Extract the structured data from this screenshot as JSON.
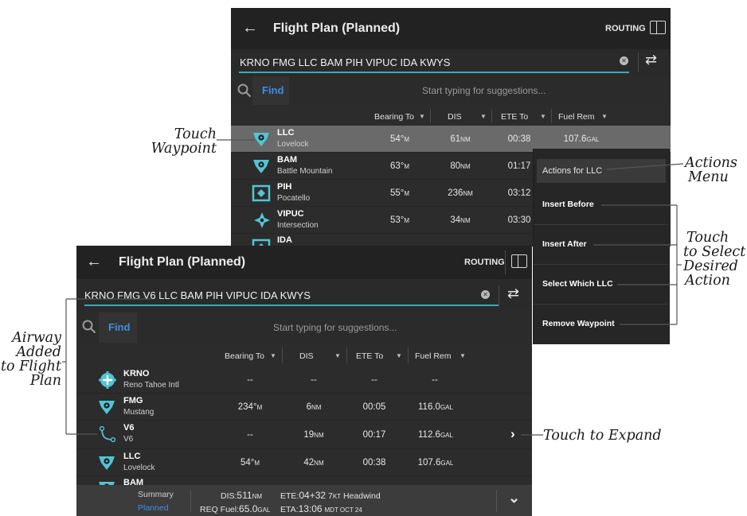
{
  "back_panel": {
    "title": "Flight Plan (Planned)",
    "routing_label": "ROUTING",
    "route_text": "KRNO FMG LLC BAM PIH VIPUC IDA KWYS",
    "find_label": "Find",
    "suggestion_placeholder": "Start typing for suggestions...",
    "columns": [
      "Bearing To",
      "DIS",
      "ETE To",
      "Fuel Rem"
    ],
    "rows": [
      {
        "id": "LLC",
        "name": "Lovelock",
        "bearing": "54°",
        "bearing_unit": "M",
        "dis": "61",
        "dis_unit": "NM",
        "ete": "00:38",
        "fuel": "107.6",
        "fuel_unit": "GAL",
        "icon": "vor-icon"
      },
      {
        "id": "BAM",
        "name": "Battle Mountain",
        "bearing": "63°",
        "bearing_unit": "M",
        "dis": "80",
        "dis_unit": "NM",
        "ete": "01:17",
        "fuel": "",
        "fuel_unit": "",
        "icon": "vor-icon"
      },
      {
        "id": "PIH",
        "name": "Pocatello",
        "bearing": "55°",
        "bearing_unit": "M",
        "dis": "236",
        "dis_unit": "NM",
        "ete": "03:12",
        "fuel": "",
        "fuel_unit": "",
        "icon": "vortac-icon"
      },
      {
        "id": "VIPUC",
        "name": "Intersection",
        "bearing": "53°",
        "bearing_unit": "M",
        "dis": "34",
        "dis_unit": "NM",
        "ete": "03:30",
        "fuel": "",
        "fuel_unit": "",
        "icon": "intersection-icon"
      },
      {
        "id": "IDA",
        "name": "",
        "icon": "vortac-icon"
      }
    ]
  },
  "actions_menu": {
    "title": "Actions for LLC",
    "items": [
      "Insert Before",
      "Insert After",
      "Select Which LLC",
      "Remove Waypoint"
    ]
  },
  "front_panel": {
    "title": "Flight Plan (Planned)",
    "routing_label": "ROUTING",
    "route_text": "KRNO FMG V6 LLC BAM PIH VIPUC IDA KWYS",
    "find_label": "Find",
    "suggestion_placeholder": "Start typing for suggestions...",
    "columns": [
      "Bearing To",
      "DIS",
      "ETE To",
      "Fuel Rem"
    ],
    "rows": [
      {
        "id": "KRNO",
        "name": "Reno Tahoe Intl",
        "bearing": "--",
        "bearing_unit": "",
        "dis": "--",
        "dis_unit": "",
        "ete": "--",
        "fuel": "--",
        "fuel_unit": "",
        "icon": "airport-icon"
      },
      {
        "id": "FMG",
        "name": "Mustang",
        "bearing": "234°",
        "bearing_unit": "M",
        "dis": "6",
        "dis_unit": "NM",
        "ete": "00:05",
        "fuel": "116.0",
        "fuel_unit": "GAL",
        "icon": "vor-icon"
      },
      {
        "id": "V6",
        "name": "V6",
        "bearing": "--",
        "bearing_unit": "",
        "dis": "19",
        "dis_unit": "NM",
        "ete": "00:17",
        "fuel": "112.6",
        "fuel_unit": "GAL",
        "icon": "airway-icon"
      },
      {
        "id": "LLC",
        "name": "Lovelock",
        "bearing": "54°",
        "bearing_unit": "M",
        "dis": "42",
        "dis_unit": "NM",
        "ete": "00:38",
        "fuel": "107.6",
        "fuel_unit": "GAL",
        "icon": "vor-icon"
      },
      {
        "id": "BAM",
        "name": "",
        "icon": "vor-icon"
      }
    ],
    "footer": {
      "summary_label": "Summary",
      "planned_label": "Planned",
      "dis_label": "DIS:",
      "dis_value": "511",
      "dis_unit": "NM",
      "req_fuel_label": "REQ Fuel:",
      "req_fuel_value": "65.0",
      "req_fuel_unit": "GAL",
      "ete_label": "ETE:",
      "ete_value": "04+32",
      "wind_value": "7",
      "wind_unit": "KT",
      "wind_text": "Headwind",
      "eta_label": "ETA:",
      "eta_value": "13:06",
      "eta_suffix": "MDT OCT 24"
    }
  },
  "annotations": {
    "touch_waypoint": [
      "Touch",
      "Waypoint"
    ],
    "actions_menu": [
      "Actions",
      "Menu"
    ],
    "touch_select": [
      "Touch",
      "to Select",
      "Desired",
      "Action"
    ],
    "airway_added": [
      "Airway",
      "Added",
      "to Flight",
      "Plan"
    ],
    "touch_expand": "Touch to Expand"
  },
  "colors": {
    "panel_bg": "#2c2c2c",
    "header_bg": "#222222",
    "accent_teal": "#3fa7ba",
    "find_blue": "#3e8ee6",
    "selected_row": "#6a6a6a"
  }
}
